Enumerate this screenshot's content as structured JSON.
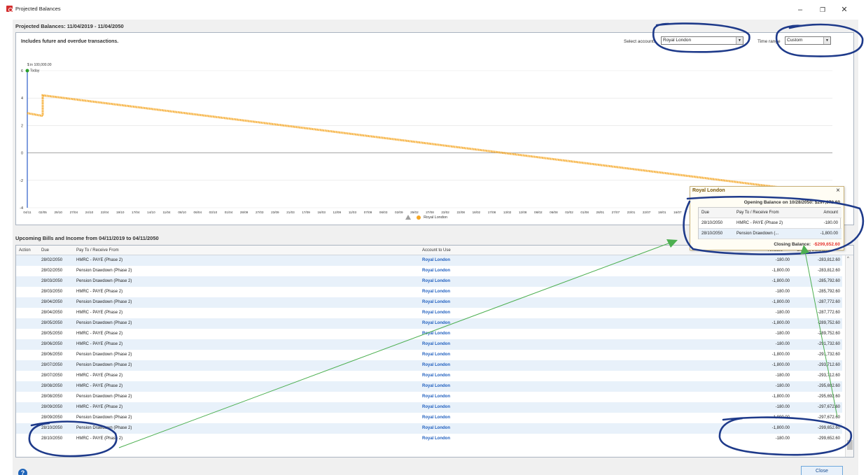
{
  "window": {
    "title": "Projected Balances",
    "minimize": "–",
    "maximize": "❐",
    "close": "✕"
  },
  "page_title": "Projected Balances: 11/04/2019 - 11/04/2050",
  "chart_note": "Includes future and overdue transactions.",
  "controls": {
    "account_label": "Select accounts",
    "account_value": "Royal London",
    "range_label": "Time range",
    "range_value": "Custom"
  },
  "chart_data": {
    "type": "line",
    "unit_label": "$ in 100,000.00",
    "today_label": "Today",
    "ylim": [
      -4,
      6
    ],
    "y_ticks": [
      "6",
      "4",
      "2",
      "0",
      "-2",
      "-4"
    ],
    "x_tick_labels": [
      "04/11",
      "02/05",
      "29/10",
      "27/04",
      "24/10",
      "22/04",
      "19/10",
      "17/04",
      "14/10",
      "11/04",
      "08/10",
      "06/04",
      "03/10",
      "01/04",
      "28/09",
      "27/03",
      "23/09",
      "21/03",
      "17/09",
      "16/03",
      "12/09",
      "11/03",
      "07/09",
      "06/03",
      "02/09",
      "29/02",
      "27/08",
      "23/02",
      "22/08",
      "18/02",
      "17/08",
      "13/02",
      "12/08",
      "08/02",
      "06/08",
      "02/02",
      "01/08",
      "28/01",
      "27/07",
      "23/01",
      "22/07",
      "18/01",
      "16/07",
      "12/01",
      "11/07",
      "07/01",
      "06/07",
      "02/01",
      "01/07",
      "28/12",
      "25/06",
      "22/12",
      "20/0"
    ],
    "series": [
      {
        "name": "Royal London",
        "color": "#f5a623",
        "start": 2.9,
        "dip": 2.7,
        "jump": 4.2,
        "end": -2.99652
      }
    ],
    "legend_position": "bottom-center"
  },
  "legend": {
    "warning_icon": "warning-icon",
    "series_name": "Royal London"
  },
  "bills": {
    "title": "Upcoming Bills and Income from 04/11/2019 to 04/11/2050",
    "columns": [
      "Action",
      "Due",
      "Pay To / Receive From",
      "Account to Use",
      "Amount",
      "Closing Balance"
    ],
    "rows": [
      {
        "due": "28/02/2050",
        "payee": "HMRC - PAYE (Phase 2)",
        "account": "Royal London",
        "amount": "-180.00",
        "balance": "-283,812.60"
      },
      {
        "due": "28/02/2050",
        "payee": "Pension Drawdown (Phase 2)",
        "account": "Royal London",
        "amount": "-1,800.00",
        "balance": "-283,812.60"
      },
      {
        "due": "28/03/2050",
        "payee": "Pension Drawdown (Phase 2)",
        "account": "Royal London",
        "amount": "-1,800.00",
        "balance": "-285,792.60"
      },
      {
        "due": "28/03/2050",
        "payee": "HMRC - PAYE (Phase 2)",
        "account": "Royal London",
        "amount": "-180.00",
        "balance": "-285,792.60"
      },
      {
        "due": "28/04/2050",
        "payee": "Pension Drawdown (Phase 2)",
        "account": "Royal London",
        "amount": "-1,800.00",
        "balance": "-287,772.60"
      },
      {
        "due": "28/04/2050",
        "payee": "HMRC - PAYE (Phase 2)",
        "account": "Royal London",
        "amount": "-180.00",
        "balance": "-287,772.60"
      },
      {
        "due": "28/05/2050",
        "payee": "Pension Drawdown (Phase 2)",
        "account": "Royal London",
        "amount": "-1,800.00",
        "balance": "-289,752.60"
      },
      {
        "due": "28/05/2050",
        "payee": "HMRC - PAYE (Phase 2)",
        "account": "Royal London",
        "amount": "-180.00",
        "balance": "-289,752.60"
      },
      {
        "due": "28/06/2050",
        "payee": "HMRC - PAYE (Phase 2)",
        "account": "Royal London",
        "amount": "-180.00",
        "balance": "-291,732.60"
      },
      {
        "due": "28/06/2050",
        "payee": "Pension Drawdown (Phase 2)",
        "account": "Royal London",
        "amount": "-1,800.00",
        "balance": "-291,732.60"
      },
      {
        "due": "28/07/2050",
        "payee": "Pension Drawdown (Phase 2)",
        "account": "Royal London",
        "amount": "-1,800.00",
        "balance": "-293,712.60"
      },
      {
        "due": "28/07/2050",
        "payee": "HMRC - PAYE (Phase 2)",
        "account": "Royal London",
        "amount": "-180.00",
        "balance": "-293,712.60"
      },
      {
        "due": "28/08/2050",
        "payee": "HMRC - PAYE (Phase 2)",
        "account": "Royal London",
        "amount": "-180.00",
        "balance": "-295,692.60"
      },
      {
        "due": "28/08/2050",
        "payee": "Pension Drawdown (Phase 2)",
        "account": "Royal London",
        "amount": "-1,800.00",
        "balance": "-295,692.60"
      },
      {
        "due": "28/09/2050",
        "payee": "HMRC - PAYE (Phase 2)",
        "account": "Royal London",
        "amount": "-180.00",
        "balance": "-297,672.60"
      },
      {
        "due": "28/09/2050",
        "payee": "Pension Drawdown (Phase 2)",
        "account": "Royal London",
        "amount": "-1,800.00",
        "balance": "-297,672.60"
      },
      {
        "due": "28/10/2050",
        "payee": "Pension Drawdown (Phase 2)",
        "account": "Royal London",
        "amount": "-1,800.00",
        "balance": "-299,652.60"
      },
      {
        "due": "28/10/2050",
        "payee": "HMRC - PAYE (Phase 2)",
        "account": "Royal London",
        "amount": "-180.00",
        "balance": "-299,652.60"
      }
    ]
  },
  "tooltip": {
    "title": "Royal London",
    "opening": "Opening Balance on 10/28/2050:  $297,672.60",
    "columns": [
      "Due",
      "Pay To / Receive From",
      "Amount"
    ],
    "rows": [
      {
        "due": "28/10/2050",
        "payee": "HMRC - PAYE (Phase 2)",
        "amount": "-180.00"
      },
      {
        "due": "28/10/2050",
        "payee": "Pension Drawdown (...",
        "amount": "-1,800.00"
      }
    ],
    "closing_label": "Closing Balance:",
    "closing_value": "-$299,652.60"
  },
  "footer": {
    "help_icon": "help-icon",
    "help_glyph": "?",
    "close_label": "Close"
  },
  "annotation_color": "#1e3a8a",
  "arrow_color": "#4caf50"
}
